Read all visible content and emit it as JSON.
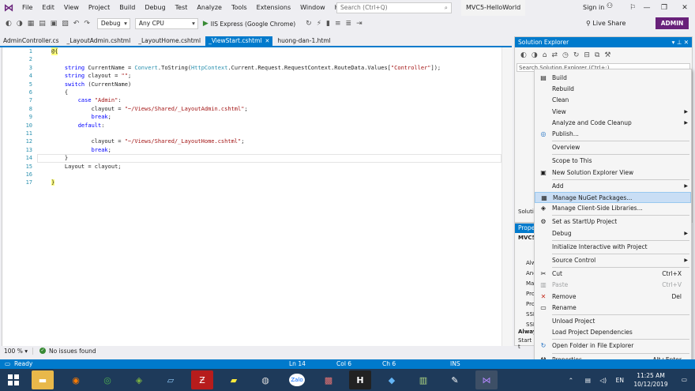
{
  "app": {
    "menu": [
      "File",
      "Edit",
      "View",
      "Project",
      "Build",
      "Debug",
      "Test",
      "Analyze",
      "Tools",
      "Extensions",
      "Window",
      "Help"
    ],
    "search_placeholder": "Search (Ctrl+Q)",
    "solution_name": "MVC5-HelloWorld",
    "sign_in": "Sign in",
    "live_share": "Live Share",
    "user_badge": "ADMIN"
  },
  "toolbar": {
    "config": "Debug",
    "platform": "Any CPU",
    "run_target": "IIS Express (Google Chrome)"
  },
  "tabs": [
    {
      "label": "AdminController.cs",
      "active": false
    },
    {
      "label": "_LayoutAdmin.cshtml",
      "active": false
    },
    {
      "label": "_LayoutHome.cshtml",
      "active": false
    },
    {
      "label": "_ViewStart.cshtml",
      "active": true
    },
    {
      "label": "huong-dan-1.html",
      "active": false
    }
  ],
  "editor": {
    "line_numbers": [
      "1",
      "2",
      "3",
      "4",
      "5",
      "6",
      "7",
      "8",
      "9",
      "10",
      "11",
      "12",
      "13",
      "14",
      "15",
      "16",
      "17"
    ],
    "zoom": "100 %",
    "issues": "No issues found"
  },
  "solution_explorer": {
    "title": "Solution Explorer",
    "search_placeholder": "Search Solution Explorer (Ctrl+;)",
    "partial_label": "Soluti"
  },
  "properties": {
    "title": "Prope",
    "project": "MVC5",
    "rows": [
      "Alw",
      "Anc",
      "Ma",
      "Pro",
      "Pro",
      "SSL",
      "SSL",
      "Alway",
      "Start t"
    ]
  },
  "context_menu": [
    {
      "label": "Build",
      "icon": "build-icon"
    },
    {
      "label": "Rebuild"
    },
    {
      "label": "Clean"
    },
    {
      "label": "View",
      "submenu": true
    },
    {
      "label": "Analyze and Code Cleanup",
      "submenu": true
    },
    {
      "label": "Publish...",
      "icon": "globe-icon"
    },
    {
      "sep": true
    },
    {
      "label": "Overview"
    },
    {
      "sep": true
    },
    {
      "label": "Scope to This"
    },
    {
      "label": "New Solution Explorer View",
      "icon": "window-icon"
    },
    {
      "sep": true
    },
    {
      "label": "Add",
      "submenu": true
    },
    {
      "label": "Manage NuGet Packages...",
      "icon": "nuget-icon",
      "highlight": true
    },
    {
      "label": "Manage Client-Side Libraries...",
      "icon": "library-icon"
    },
    {
      "sep": true
    },
    {
      "label": "Set as StartUp Project",
      "icon": "gear-icon"
    },
    {
      "label": "Debug",
      "submenu": true
    },
    {
      "sep": true
    },
    {
      "label": "Initialize Interactive with Project"
    },
    {
      "sep": true
    },
    {
      "label": "Source Control",
      "submenu": true
    },
    {
      "sep": true
    },
    {
      "label": "Cut",
      "shortcut": "Ctrl+X",
      "icon": "cut-icon"
    },
    {
      "label": "Paste",
      "shortcut": "Ctrl+V",
      "icon": "paste-icon",
      "disabled": true
    },
    {
      "label": "Remove",
      "shortcut": "Del",
      "icon": "remove-icon"
    },
    {
      "label": "Rename",
      "icon": "rename-icon"
    },
    {
      "sep": true
    },
    {
      "label": "Unload Project"
    },
    {
      "label": "Load Project Dependencies"
    },
    {
      "sep": true
    },
    {
      "label": "Open Folder in File Explorer",
      "icon": "refresh-icon"
    },
    {
      "sep": true
    },
    {
      "label": "Properties",
      "shortcut": "Alt+Enter",
      "icon": "wrench-icon"
    }
  ],
  "statusbar": {
    "ready": "Ready",
    "line": "Ln 14",
    "col": "Col 6",
    "ch": "Ch 6",
    "mode": "INS"
  },
  "taskbar": {
    "lang": "EN",
    "time": "11:25 AM",
    "date": "10/12/2019",
    "zalo": "Zalo"
  },
  "colors": {
    "accent": "#007acc",
    "brand": "#68217a"
  }
}
